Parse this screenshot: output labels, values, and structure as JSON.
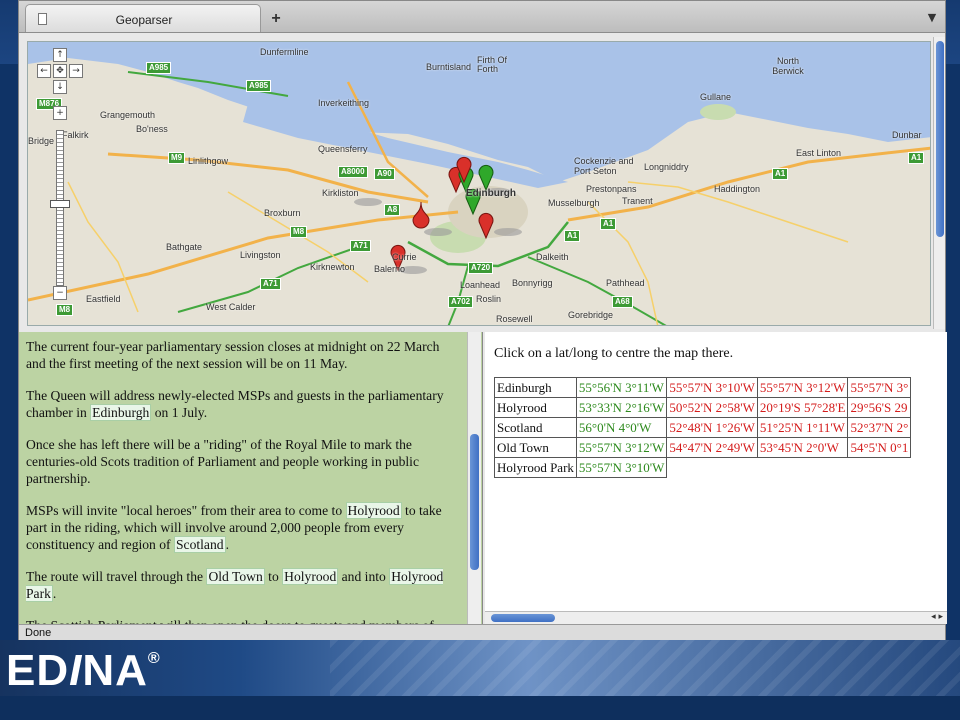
{
  "browser": {
    "tab_title": "Geoparser",
    "new_tab_label": "+",
    "tab_menu_icon": "menu",
    "status_text": "Done"
  },
  "map": {
    "places": [
      {
        "name": "Dunfermline"
      },
      {
        "name": "Burntisland"
      },
      {
        "name": "Firth Of Forth"
      },
      {
        "name": "North Berwick"
      },
      {
        "name": "Gullane"
      },
      {
        "name": "Grangemouth"
      },
      {
        "name": "Inverkeithing"
      },
      {
        "name": "Falkirk"
      },
      {
        "name": "Bo'ness"
      },
      {
        "name": "Linlithgow"
      },
      {
        "name": "Queensferry"
      },
      {
        "name": "Dunbar"
      },
      {
        "name": "East Linton"
      },
      {
        "name": "Cockenzie and Port Seton"
      },
      {
        "name": "Longniddry"
      },
      {
        "name": "Prestonpans"
      },
      {
        "name": "Haddington"
      },
      {
        "name": "Kirkliston"
      },
      {
        "name": "Edinburgh"
      },
      {
        "name": "Musselburgh"
      },
      {
        "name": "Tranent"
      },
      {
        "name": "Broxburn"
      },
      {
        "name": "Bathgate"
      },
      {
        "name": "Livingston"
      },
      {
        "name": "Kirknewton"
      },
      {
        "name": "Currie"
      },
      {
        "name": "Balerno"
      },
      {
        "name": "Dalkeith"
      },
      {
        "name": "Bonnyrigg"
      },
      {
        "name": "Pathhead"
      },
      {
        "name": "Loanhead"
      },
      {
        "name": "Roslin"
      },
      {
        "name": "Eastfield"
      },
      {
        "name": "West Calder"
      },
      {
        "name": "Rosewell"
      },
      {
        "name": "Gorebridge"
      },
      {
        "name": "Bridge"
      }
    ],
    "roads": [
      "A985",
      "A985",
      "M876",
      "M9",
      "A8000",
      "A90",
      "A8",
      "A71",
      "M8",
      "A71",
      "A720",
      "A702",
      "A68",
      "A1",
      "A1",
      "A1",
      "A1",
      "M8"
    ],
    "marker_colors": {
      "red": "#d9302a",
      "green": "#2fa82a"
    }
  },
  "article": {
    "paragraphs": [
      [
        {
          "t": "The current four-year parliamentary session closes at midnight on 22 March and the first meeting of the next session will be on 11 May."
        }
      ],
      [
        {
          "t": "The Queen will address newly-elected MSPs and guests in the parliamentary chamber in "
        },
        {
          "t": "Edinburgh",
          "hl": true
        },
        {
          "t": " on 1 July."
        }
      ],
      [
        {
          "t": "Once she has left there will be a \"riding\" of the Royal Mile to mark the centuries-old Scots tradition of Parliament and people working in public partnership."
        }
      ],
      [
        {
          "t": "MSPs will invite \"local heroes\" from their area to come to "
        },
        {
          "t": "Holyrood",
          "hl": true
        },
        {
          "t": " to take part in the riding, which will involve around 2,000 people from every constituency and region of "
        },
        {
          "t": "Scotland",
          "hl": true
        },
        {
          "t": "."
        }
      ],
      [
        {
          "t": "The route will travel through the "
        },
        {
          "t": "Old Town",
          "hl": true
        },
        {
          "t": " to "
        },
        {
          "t": "Holyrood",
          "hl": true
        },
        {
          "t": " and into "
        },
        {
          "t": "Holyrood Park",
          "hl": true
        },
        {
          "t": "."
        }
      ],
      [
        {
          "t": "The Scottish Parliament will then open the doors to guests and members of"
        }
      ]
    ]
  },
  "results": {
    "hint": "Click on a lat/long to centre the map there.",
    "rows": [
      {
        "name": "Edinburgh",
        "coords": [
          {
            "v": "55°56'N 3°11'W",
            "c": "green"
          },
          {
            "v": "55°57'N 3°10'W",
            "c": "red"
          },
          {
            "v": "55°57'N 3°12'W",
            "c": "red"
          },
          {
            "v": "55°57'N 3°",
            "c": "red"
          }
        ]
      },
      {
        "name": "Holyrood",
        "coords": [
          {
            "v": "53°33'N 2°16'W",
            "c": "green"
          },
          {
            "v": "50°52'N 2°58'W",
            "c": "red"
          },
          {
            "v": "20°19'S 57°28'E",
            "c": "red"
          },
          {
            "v": "29°56'S 29",
            "c": "red"
          }
        ]
      },
      {
        "name": "Scotland",
        "coords": [
          {
            "v": "56°0'N 4°0'W",
            "c": "green"
          },
          {
            "v": "52°48'N 1°26'W",
            "c": "red"
          },
          {
            "v": "51°25'N 1°11'W",
            "c": "red"
          },
          {
            "v": "52°37'N 2°",
            "c": "red"
          }
        ]
      },
      {
        "name": "Old Town",
        "coords": [
          {
            "v": "55°57'N 3°12'W",
            "c": "green"
          },
          {
            "v": "54°47'N 2°49'W",
            "c": "red"
          },
          {
            "v": "53°45'N 2°0'W",
            "c": "red"
          },
          {
            "v": "54°5'N 0°1",
            "c": "red"
          }
        ]
      },
      {
        "name": "Holyrood Park",
        "coords": [
          {
            "v": "55°57'N 3°10'W",
            "c": "green"
          }
        ]
      }
    ]
  },
  "branding": {
    "logo_text": "ED",
    "logo_letter": "I",
    "logo_text2": "NA",
    "logo_mark": "®"
  }
}
